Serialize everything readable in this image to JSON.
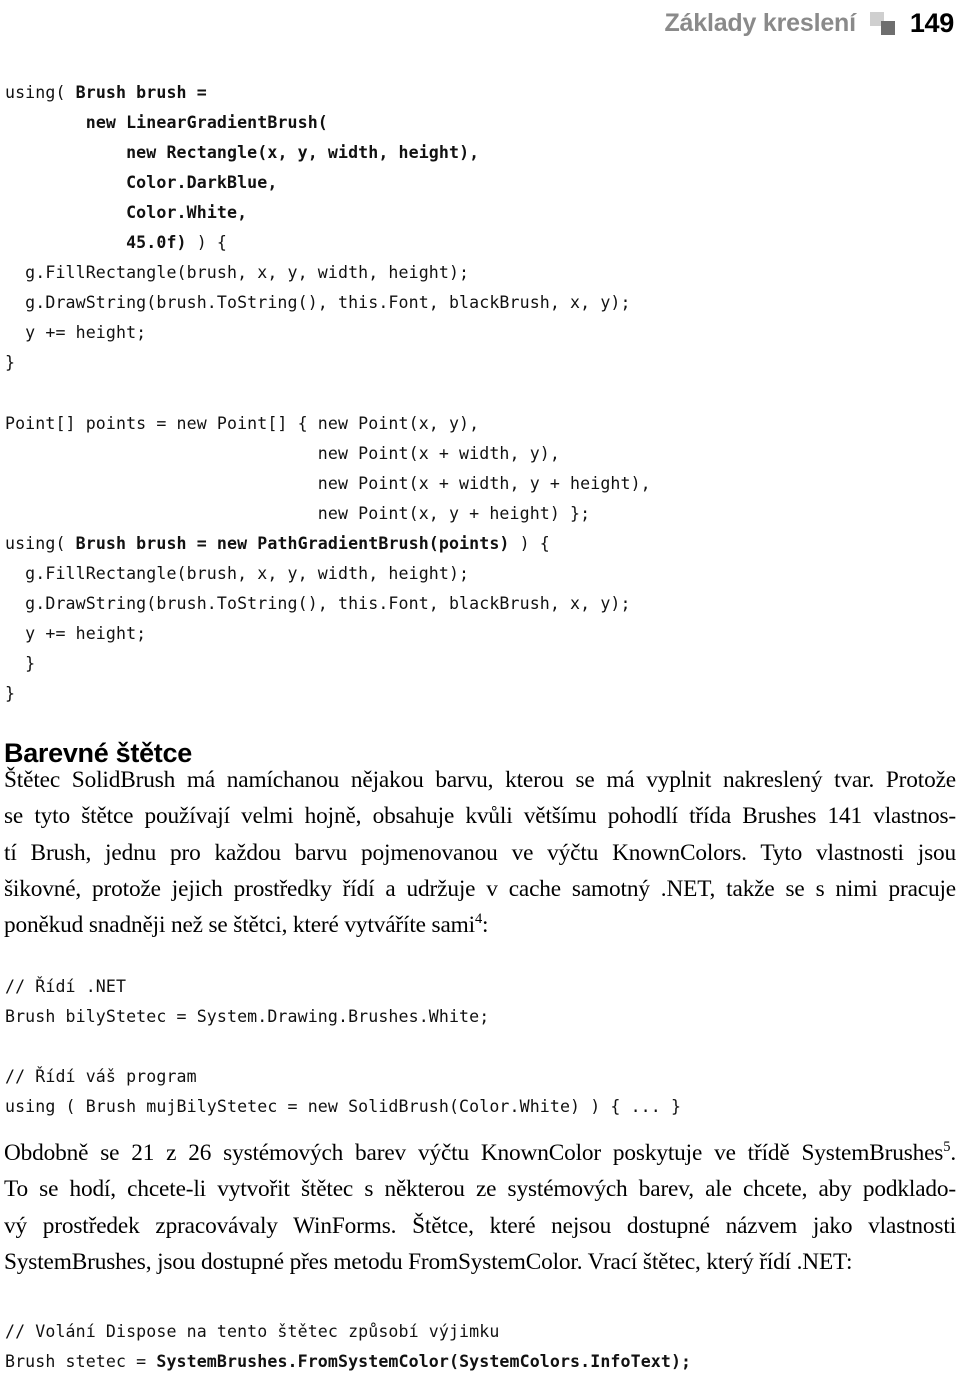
{
  "header": {
    "title": "Základy kreslení",
    "page_number": "149",
    "mark_light_color": "#cfcfcf",
    "mark_dark_color": "#6e6e6e",
    "title_color": "#8a8a8a"
  },
  "code_block_1": {
    "lines": [
      {
        "plain_before": "using( ",
        "bold": "Brush brush =",
        "plain_after": ""
      },
      {
        "plain_before": "        ",
        "bold": "new LinearGradientBrush(",
        "plain_after": ""
      },
      {
        "plain_before": "            ",
        "bold": "new Rectangle(x, y, width, height),",
        "plain_after": ""
      },
      {
        "plain_before": "            ",
        "bold": "Color.DarkBlue,",
        "plain_after": ""
      },
      {
        "plain_before": "            ",
        "bold": "Color.White,",
        "plain_after": ""
      },
      {
        "plain_before": "            ",
        "bold": "45.0f)",
        "plain_after": " ) {"
      },
      {
        "plain_before": "  g.FillRectangle(brush, x, y, width, height);",
        "bold": "",
        "plain_after": ""
      },
      {
        "plain_before": "  g.DrawString(brush.ToString(), this.Font, blackBrush, x, y);",
        "bold": "",
        "plain_after": ""
      },
      {
        "plain_before": "  y += height;",
        "bold": "",
        "plain_after": ""
      },
      {
        "plain_before": "}",
        "bold": "",
        "plain_after": ""
      },
      {
        "plain_before": "",
        "bold": "",
        "plain_after": ""
      },
      {
        "plain_before": "Point[] points = new Point[] { new Point(x, y),",
        "bold": "",
        "plain_after": ""
      },
      {
        "plain_before": "                               new Point(x + width, y),",
        "bold": "",
        "plain_after": ""
      },
      {
        "plain_before": "                               new Point(x + width, y + height),",
        "bold": "",
        "plain_after": ""
      },
      {
        "plain_before": "                               new Point(x, y + height) };",
        "bold": "",
        "plain_after": ""
      },
      {
        "plain_before": "using( ",
        "bold": "Brush brush = new PathGradientBrush(points)",
        "plain_after": " ) {"
      },
      {
        "plain_before": "  g.FillRectangle(brush, x, y, width, height);",
        "bold": "",
        "plain_after": ""
      },
      {
        "plain_before": "  g.DrawString(brush.ToString(), this.Font, blackBrush, x, y);",
        "bold": "",
        "plain_after": ""
      },
      {
        "plain_before": "  y += height;",
        "bold": "",
        "plain_after": ""
      },
      {
        "plain_before": "  }",
        "bold": "",
        "plain_after": ""
      },
      {
        "plain_before": "}",
        "bold": "",
        "plain_after": ""
      }
    ]
  },
  "heading": "Barevné štětce",
  "paragraph_1": {
    "lines": [
      "Štětec SolidBrush má namíchanou nějakou barvu, kterou se má vyplnit nakreslený tvar. Protože",
      "se tyto štětce používají velmi hojně, obsahuje kvůli většímu pohodlí třída Brushes 141 vlastnos-",
      "tí Brush, jednu pro každou barvu pojmenovanou ve výčtu KnownColors. Tyto vlastnosti jsou",
      "šikovné, protože jejich prostředky řídí a udržuje v cache samotný .NET, takže se s nimi pracuje",
      "poněkud snadněji než se štětci, které vytváříte sami"
    ],
    "footnote_marker": "4",
    "trailing": ":"
  },
  "code_block_2": {
    "lines": [
      {
        "plain_before": "// Řídí .NET",
        "bold": "",
        "plain_after": ""
      },
      {
        "plain_before": "Brush bilyStetec = System.Drawing.Brushes.White;",
        "bold": "",
        "plain_after": ""
      },
      {
        "plain_before": "",
        "bold": "",
        "plain_after": ""
      },
      {
        "plain_before": "// Řídí váš program",
        "bold": "",
        "plain_after": ""
      },
      {
        "plain_before": "using ( Brush mujBilyStetec = new SolidBrush(Color.White) ) { ... }",
        "bold": "",
        "plain_after": ""
      }
    ]
  },
  "paragraph_2": {
    "line_1_before": "Obdobně se 21 z 26 systémových barev výčtu KnownColor poskytuje ve třídě SystemBrushes",
    "footnote_marker": "5",
    "line_1_after": ".",
    "lines_rest": [
      "To se hodí, chcete-li vytvořit štětec s některou ze systémových barev, ale chcete, aby podklado-",
      "vý prostředek zpracovávaly WinForms. Štětce, které nejsou dostupné názvem jako vlastnosti",
      "SystemBrushes, jsou dostupné přes metodu FromSystemColor. Vrací štětec, který řídí .NET:"
    ]
  },
  "code_block_3": {
    "lines": [
      {
        "plain_before": "// Volání Dispose na tento štětec způsobí výjimku",
        "bold": "",
        "plain_after": ""
      },
      {
        "plain_before": "Brush stetec = ",
        "bold": "SystemBrushes.FromSystemColor(SystemColors.InfoText);",
        "plain_after": ""
      }
    ]
  }
}
